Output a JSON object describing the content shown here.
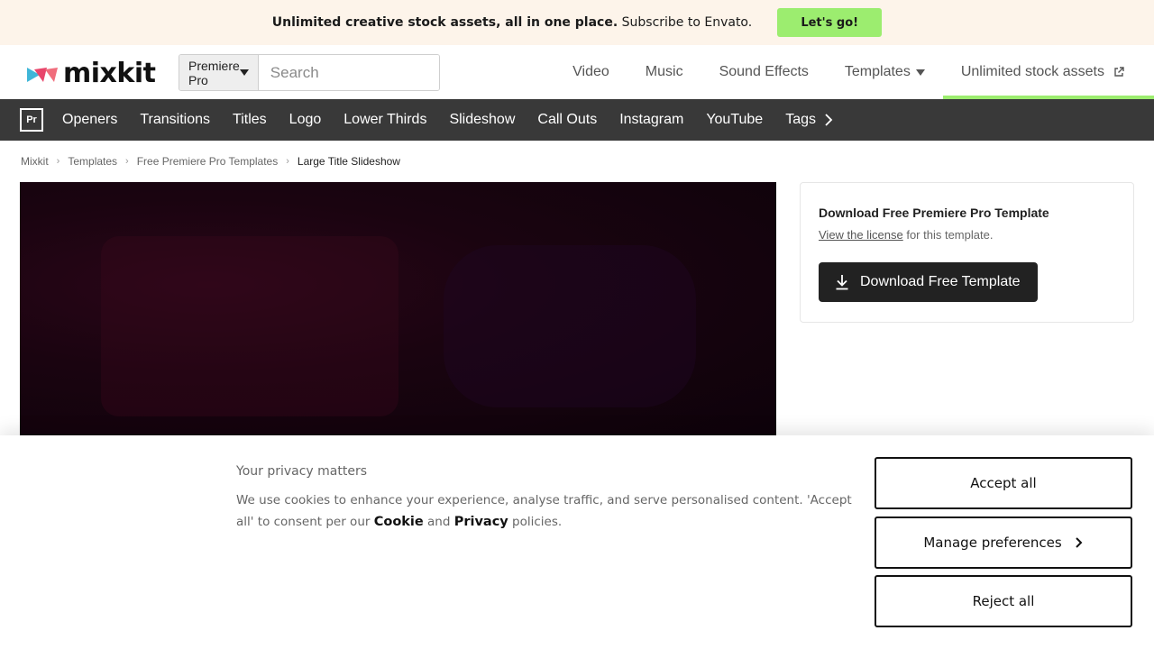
{
  "promo": {
    "text_bold": "Unlimited creative stock assets, all in one place.",
    "text_rest": " Subscribe to Envato.",
    "button": "Let's go!",
    "button_color": "#9ced6f"
  },
  "header": {
    "logo_text": "mixkit",
    "search": {
      "category": "Premiere Pro",
      "placeholder": "Search"
    },
    "nav": [
      {
        "label": "Video"
      },
      {
        "label": "Music"
      },
      {
        "label": "Sound Effects"
      },
      {
        "label": "Templates"
      },
      {
        "label": "Unlimited stock assets"
      }
    ]
  },
  "subnav": {
    "badge": "Pr",
    "links": [
      "Openers",
      "Transitions",
      "Titles",
      "Logo",
      "Lower Thirds",
      "Slideshow",
      "Call Outs",
      "Instagram",
      "YouTube",
      "Tags"
    ]
  },
  "breadcrumb": [
    "Mixkit",
    "Templates",
    "Free Premiere Pro Templates",
    "Large Title Slideshow"
  ],
  "download": {
    "title": "Download Free Premiere Pro Template",
    "license_link": "View the license",
    "license_rest": " for this template.",
    "button": "Download Free Template"
  },
  "cookie": {
    "title": "Your privacy matters",
    "body_start": "We use cookies to enhance your experience, analyse traffic, and serve personalised content. 'Accept all' to consent per our ",
    "cookie_link": "Cookie",
    "and": " and ",
    "privacy_link": "Privacy",
    "body_end": " policies.",
    "accept": "Accept all",
    "manage": "Manage preferences",
    "reject": "Reject all"
  }
}
